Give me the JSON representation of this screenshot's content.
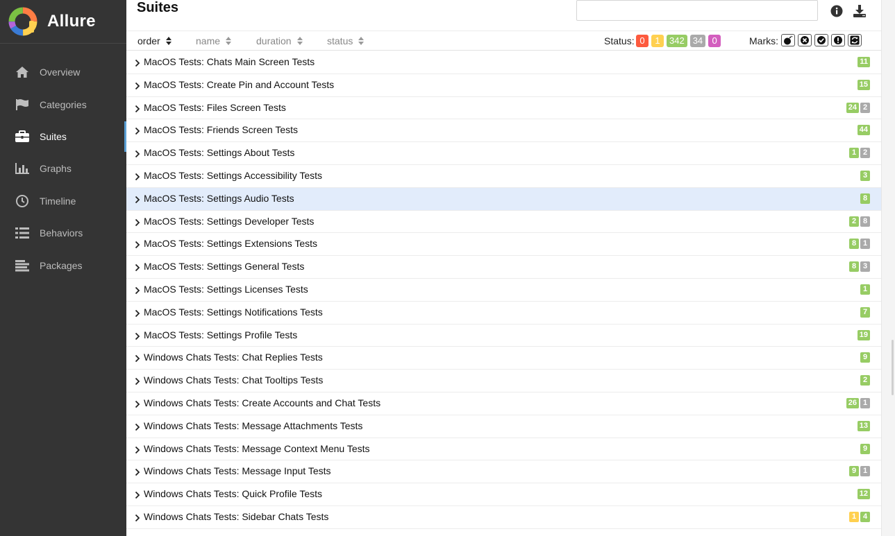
{
  "brand": {
    "title": "Allure"
  },
  "sidebar": {
    "items": [
      {
        "label": "Overview",
        "icon": "home-icon",
        "active": false
      },
      {
        "label": "Categories",
        "icon": "flag-icon",
        "active": false
      },
      {
        "label": "Suites",
        "icon": "briefcase-icon",
        "active": true
      },
      {
        "label": "Graphs",
        "icon": "bar-chart-icon",
        "active": false
      },
      {
        "label": "Timeline",
        "icon": "clock-icon",
        "active": false
      },
      {
        "label": "Behaviors",
        "icon": "list-icon",
        "active": false
      },
      {
        "label": "Packages",
        "icon": "align-left-icon",
        "active": false
      }
    ]
  },
  "main": {
    "title": "Suites",
    "search": {
      "value": "",
      "placeholder": ""
    },
    "sorters": [
      "order",
      "name",
      "duration",
      "status"
    ],
    "status_label": "Status:",
    "status_filters": [
      {
        "value": "0",
        "color": "#fd5a3e"
      },
      {
        "value": "1",
        "color": "#ffd050"
      },
      {
        "value": "342",
        "color": "#97cc64"
      },
      {
        "value": "34",
        "color": "#aaaaaa"
      },
      {
        "value": "0",
        "color": "#d35ebe"
      }
    ],
    "marks_label": "Marks:",
    "marks": [
      "flaky-icon",
      "new-failed-icon",
      "new-passed-icon",
      "new-broken-icon",
      "retries-icon"
    ],
    "suites": [
      {
        "name": "MacOS Tests: Chats Main Screen Tests",
        "counts": [
          {
            "v": "11",
            "t": "passed"
          }
        ]
      },
      {
        "name": "MacOS Tests: Create Pin and Account Tests",
        "counts": [
          {
            "v": "15",
            "t": "passed"
          }
        ]
      },
      {
        "name": "MacOS Tests: Files Screen Tests",
        "counts": [
          {
            "v": "24",
            "t": "passed"
          },
          {
            "v": "2",
            "t": "skipped"
          }
        ]
      },
      {
        "name": "MacOS Tests: Friends Screen Tests",
        "counts": [
          {
            "v": "44",
            "t": "passed"
          }
        ]
      },
      {
        "name": "MacOS Tests: Settings About Tests",
        "counts": [
          {
            "v": "1",
            "t": "passed"
          },
          {
            "v": "2",
            "t": "skipped"
          }
        ]
      },
      {
        "name": "MacOS Tests: Settings Accessibility Tests",
        "counts": [
          {
            "v": "3",
            "t": "passed"
          }
        ]
      },
      {
        "name": "MacOS Tests: Settings Audio Tests",
        "counts": [
          {
            "v": "8",
            "t": "passed"
          }
        ],
        "selected": true
      },
      {
        "name": "MacOS Tests: Settings Developer Tests",
        "counts": [
          {
            "v": "2",
            "t": "passed"
          },
          {
            "v": "8",
            "t": "skipped"
          }
        ]
      },
      {
        "name": "MacOS Tests: Settings Extensions Tests",
        "counts": [
          {
            "v": "8",
            "t": "passed"
          },
          {
            "v": "1",
            "t": "skipped"
          }
        ]
      },
      {
        "name": "MacOS Tests: Settings General Tests",
        "counts": [
          {
            "v": "8",
            "t": "passed"
          },
          {
            "v": "3",
            "t": "skipped"
          }
        ]
      },
      {
        "name": "MacOS Tests: Settings Licenses Tests",
        "counts": [
          {
            "v": "1",
            "t": "passed"
          }
        ]
      },
      {
        "name": "MacOS Tests: Settings Notifications Tests",
        "counts": [
          {
            "v": "7",
            "t": "passed"
          }
        ]
      },
      {
        "name": "MacOS Tests: Settings Profile Tests",
        "counts": [
          {
            "v": "19",
            "t": "passed"
          }
        ]
      },
      {
        "name": "Windows Chats Tests: Chat Replies Tests",
        "counts": [
          {
            "v": "9",
            "t": "passed"
          }
        ]
      },
      {
        "name": "Windows Chats Tests: Chat Tooltips Tests",
        "counts": [
          {
            "v": "2",
            "t": "passed"
          }
        ]
      },
      {
        "name": "Windows Chats Tests: Create Accounts and Chat Tests",
        "counts": [
          {
            "v": "26",
            "t": "passed"
          },
          {
            "v": "1",
            "t": "skipped"
          }
        ]
      },
      {
        "name": "Windows Chats Tests: Message Attachments Tests",
        "counts": [
          {
            "v": "13",
            "t": "passed"
          }
        ]
      },
      {
        "name": "Windows Chats Tests: Message Context Menu Tests",
        "counts": [
          {
            "v": "9",
            "t": "passed"
          }
        ]
      },
      {
        "name": "Windows Chats Tests: Message Input Tests",
        "counts": [
          {
            "v": "9",
            "t": "passed"
          },
          {
            "v": "1",
            "t": "skipped"
          }
        ]
      },
      {
        "name": "Windows Chats Tests: Quick Profile Tests",
        "counts": [
          {
            "v": "12",
            "t": "passed"
          }
        ]
      },
      {
        "name": "Windows Chats Tests: Sidebar Chats Tests",
        "counts": [
          {
            "v": "1",
            "t": "broken"
          },
          {
            "v": "4",
            "t": "passed"
          }
        ]
      }
    ]
  }
}
